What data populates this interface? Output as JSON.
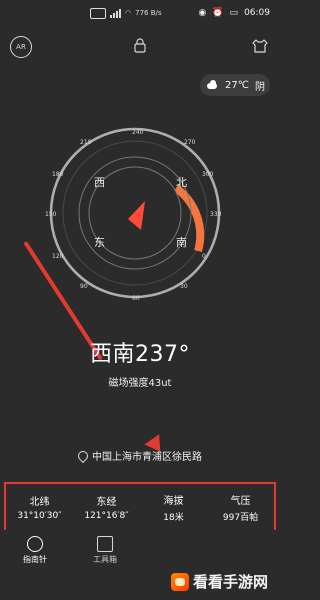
{
  "status_bar": {
    "left_text": "776 B/s",
    "time": "06:09",
    "battery": ""
  },
  "top_actions": {
    "ar_label": "AR"
  },
  "weather": {
    "temperature": "27℃",
    "condition": "阴"
  },
  "compass": {
    "marks": [
      "240",
      "270",
      "300",
      "330",
      "0",
      "30",
      "60",
      "90",
      "120",
      "150",
      "180",
      "210"
    ],
    "directions": [
      "西",
      "北",
      "东",
      "南"
    ]
  },
  "heading": {
    "value": "西南237°",
    "field_strength": "磁场强度43ut"
  },
  "location": {
    "address": "中国上海市青浦区徐民路"
  },
  "stats": [
    {
      "label": "北纬",
      "value": "31°10′30″"
    },
    {
      "label": "东经",
      "value": "121°16′8″"
    },
    {
      "label": "海拔",
      "value": "18米"
    },
    {
      "label": "气压",
      "value": "997百帕"
    }
  ],
  "nav": {
    "tabs": [
      {
        "label": "指南针"
      },
      {
        "label": "工具箱"
      }
    ]
  },
  "watermark": {
    "text": "看看手游网"
  }
}
